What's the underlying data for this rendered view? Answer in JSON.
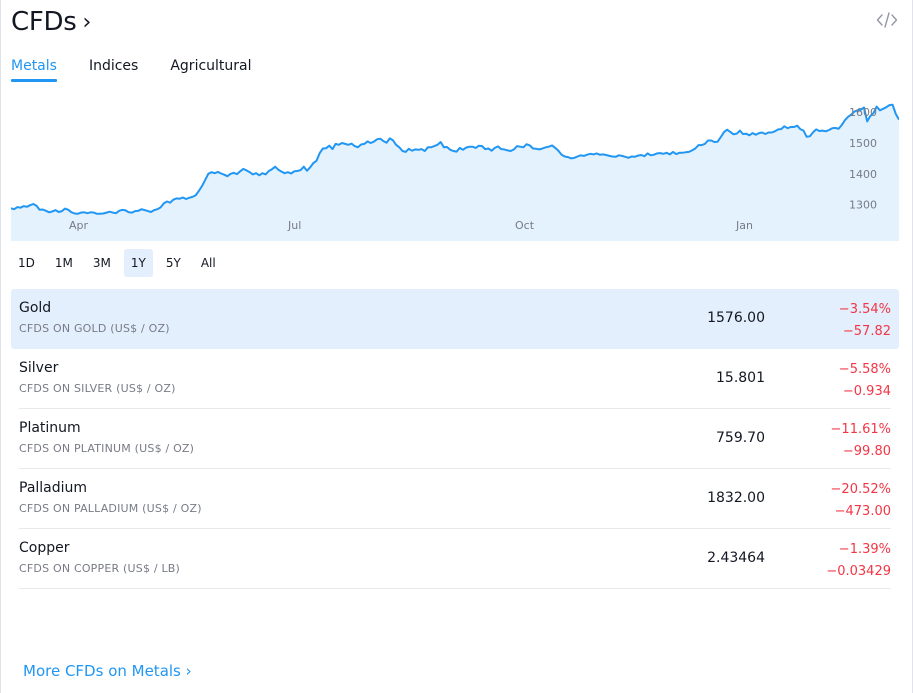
{
  "header": {
    "title": "CFDs",
    "chevron": "›"
  },
  "tabs": [
    {
      "label": "Metals",
      "active": true
    },
    {
      "label": "Indices",
      "active": false
    },
    {
      "label": "Agricultural",
      "active": false
    }
  ],
  "chart_data": {
    "type": "area",
    "series_color": "#2196f3",
    "fill_color": "#e3f2fd",
    "x_tick_labels": [
      "Apr",
      "Jul",
      "Oct",
      "Jan"
    ],
    "y_tick_labels": [
      "1300",
      "1400",
      "1500",
      "1600"
    ],
    "ylim": [
      1250,
      1620
    ],
    "grid": false,
    "values": [
      1288,
      1285,
      1292,
      1290,
      1295,
      1293,
      1298,
      1302,
      1296,
      1283,
      1284,
      1280,
      1275,
      1278,
      1282,
      1276,
      1279,
      1287,
      1283,
      1275,
      1271,
      1270,
      1274,
      1275,
      1272,
      1275,
      1274,
      1270,
      1270,
      1271,
      1274,
      1277,
      1274,
      1272,
      1280,
      1283,
      1281,
      1275,
      1274,
      1279,
      1280,
      1285,
      1282,
      1279,
      1276,
      1282,
      1285,
      1291,
      1304,
      1310,
      1306,
      1316,
      1320,
      1319,
      1323,
      1318,
      1322,
      1325,
      1330,
      1344,
      1360,
      1380,
      1400,
      1405,
      1402,
      1406,
      1401,
      1397,
      1392,
      1400,
      1403,
      1399,
      1408,
      1416,
      1411,
      1405,
      1398,
      1402,
      1395,
      1402,
      1398,
      1409,
      1415,
      1423,
      1413,
      1407,
      1402,
      1405,
      1401,
      1408,
      1409,
      1412,
      1423,
      1410,
      1421,
      1435,
      1442,
      1467,
      1482,
      1483,
      1491,
      1480,
      1497,
      1494,
      1500,
      1497,
      1494,
      1498,
      1490,
      1486,
      1495,
      1497,
      1505,
      1500,
      1504,
      1512,
      1514,
      1506,
      1501,
      1515,
      1509,
      1494,
      1486,
      1474,
      1471,
      1481,
      1475,
      1479,
      1478,
      1480,
      1474,
      1486,
      1486,
      1490,
      1494,
      1503,
      1486,
      1487,
      1478,
      1474,
      1472,
      1484,
      1478,
      1485,
      1488,
      1488,
      1484,
      1491,
      1490,
      1480,
      1482,
      1475,
      1484,
      1489,
      1480,
      1479,
      1476,
      1474,
      1479,
      1490,
      1488,
      1486,
      1496,
      1492,
      1482,
      1481,
      1479,
      1482,
      1486,
      1488,
      1492,
      1484,
      1475,
      1462,
      1456,
      1454,
      1450,
      1452,
      1456,
      1460,
      1458,
      1462,
      1465,
      1463,
      1466,
      1462,
      1463,
      1461,
      1458,
      1456,
      1455,
      1460,
      1458,
      1455,
      1452,
      1456,
      1455,
      1459,
      1461,
      1457,
      1466,
      1460,
      1462,
      1466,
      1467,
      1465,
      1468,
      1463,
      1471,
      1464,
      1468,
      1468,
      1470,
      1471,
      1476,
      1482,
      1493,
      1493,
      1497,
      1508,
      1508,
      1503,
      1504,
      1519,
      1535,
      1543,
      1536,
      1528,
      1530,
      1540,
      1529,
      1530,
      1525,
      1532,
      1527,
      1532,
      1534,
      1529,
      1534,
      1534,
      1538,
      1544,
      1545,
      1554,
      1548,
      1552,
      1552,
      1556,
      1545,
      1540,
      1520,
      1522,
      1535,
      1544,
      1539,
      1540,
      1538,
      1542,
      1548,
      1549,
      1546,
      1558,
      1574,
      1585,
      1592,
      1602,
      1606,
      1608,
      1615,
      1570,
      1588,
      1597,
      1618,
      1606,
      1611,
      1616,
      1623,
      1624,
      1594,
      1576
    ]
  },
  "periods": [
    {
      "label": "1D",
      "active": false
    },
    {
      "label": "1M",
      "active": false
    },
    {
      "label": "3M",
      "active": false
    },
    {
      "label": "1Y",
      "active": true
    },
    {
      "label": "5Y",
      "active": false
    },
    {
      "label": "All",
      "active": false
    }
  ],
  "rows": [
    {
      "name": "Gold",
      "desc": "CFDS ON GOLD (US$ / OZ)",
      "price": "1576.00",
      "chg_pct": "−3.54%",
      "chg_abs": "−57.82",
      "selected": true
    },
    {
      "name": "Silver",
      "desc": "CFDS ON SILVER (US$ / OZ)",
      "price": "15.801",
      "chg_pct": "−5.58%",
      "chg_abs": "−0.934",
      "selected": false
    },
    {
      "name": "Platinum",
      "desc": "CFDS ON PLATINUM (US$ / OZ)",
      "price": "759.70",
      "chg_pct": "−11.61%",
      "chg_abs": "−99.80",
      "selected": false
    },
    {
      "name": "Palladium",
      "desc": "CFDS ON PALLADIUM (US$ / OZ)",
      "price": "1832.00",
      "chg_pct": "−20.52%",
      "chg_abs": "−473.00",
      "selected": false
    },
    {
      "name": "Copper",
      "desc": "CFDS ON COPPER (US$ / LB)",
      "price": "2.43464",
      "chg_pct": "−1.39%",
      "chg_abs": "−0.03429",
      "selected": false
    }
  ],
  "footer": {
    "more_link": "More CFDs on Metals ›"
  },
  "colors": {
    "accent": "#2196f3",
    "negative": "#f23645",
    "selected_bg": "#e3effd"
  },
  "icons": {
    "embed": "code-icon"
  }
}
